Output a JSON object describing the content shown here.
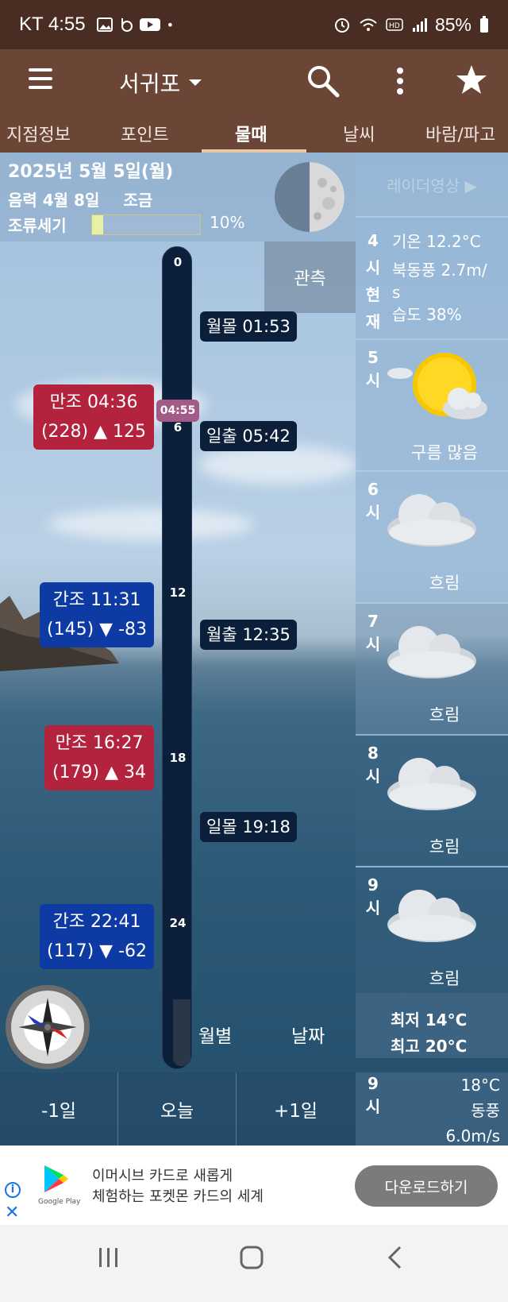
{
  "status": {
    "carrier_time": "KT 4:55",
    "battery": "85%"
  },
  "appbar": {
    "location": "서귀포"
  },
  "tabs": [
    "지점정보",
    "포인트",
    "물때",
    "날씨",
    "바람/파고"
  ],
  "info": {
    "date": "2025년 5월 5일(월)",
    "lunar": "음력 4월 8일",
    "tide_name": "조금",
    "flow_label": "조류세기",
    "flow_pct": "10%",
    "flow_fraction": 0.1
  },
  "radar_label": "레이더영상 ▶",
  "observe_label": "관측",
  "timeline": {
    "ticks": [
      "0",
      "6",
      "12",
      "18",
      "24"
    ],
    "now": "04:55"
  },
  "events": [
    {
      "label": "월몰 01:53"
    },
    {
      "label": "일출 05:42"
    },
    {
      "label": "월출 12:35"
    },
    {
      "label": "일몰 19:18"
    }
  ],
  "tides": [
    {
      "line1": "만조 04:36",
      "line2": "(228) ▲ 125"
    },
    {
      "line1": "간조 11:31",
      "line2": "(145) ▼ -83"
    },
    {
      "line1": "만조 16:27",
      "line2": "(179) ▲ 34"
    },
    {
      "line1": "간조 22:41",
      "line2": "(117) ▼ -62"
    }
  ],
  "current": {
    "hour": "4시현재",
    "temp": "기온 12.2°C",
    "wind1": "북동풍 2.7m/",
    "wind2": "s",
    "humidity": "습도 38%"
  },
  "hourly": [
    {
      "hour": "5시",
      "desc": "구름 많음",
      "icon": "partly-cloudy-icon"
    },
    {
      "hour": "6시",
      "desc": "흐림",
      "icon": "cloudy-icon"
    },
    {
      "hour": "7시",
      "desc": "흐림",
      "icon": "cloudy-icon"
    },
    {
      "hour": "8시",
      "desc": "흐림",
      "icon": "cloudy-icon"
    },
    {
      "hour": "9시",
      "desc": "흐림",
      "icon": "cloudy-icon"
    }
  ],
  "minmax": {
    "min": "최저 14°C",
    "max": "최고 20°C"
  },
  "mode_buttons": {
    "monthly": "월별",
    "daily": "날짜"
  },
  "nav": {
    "prev": "-1일",
    "today": "오늘",
    "next": "+1일"
  },
  "next9": {
    "hour": "9시",
    "temp": "18°C",
    "wind_dir": "동풍",
    "wind_speed": "6.0m/s"
  },
  "ad": {
    "line1": "이머시브 카드로 새롭게",
    "line2": "체험하는 포켓몬 카드의 세계",
    "button": "다운로드하기",
    "store": "Google Play"
  }
}
